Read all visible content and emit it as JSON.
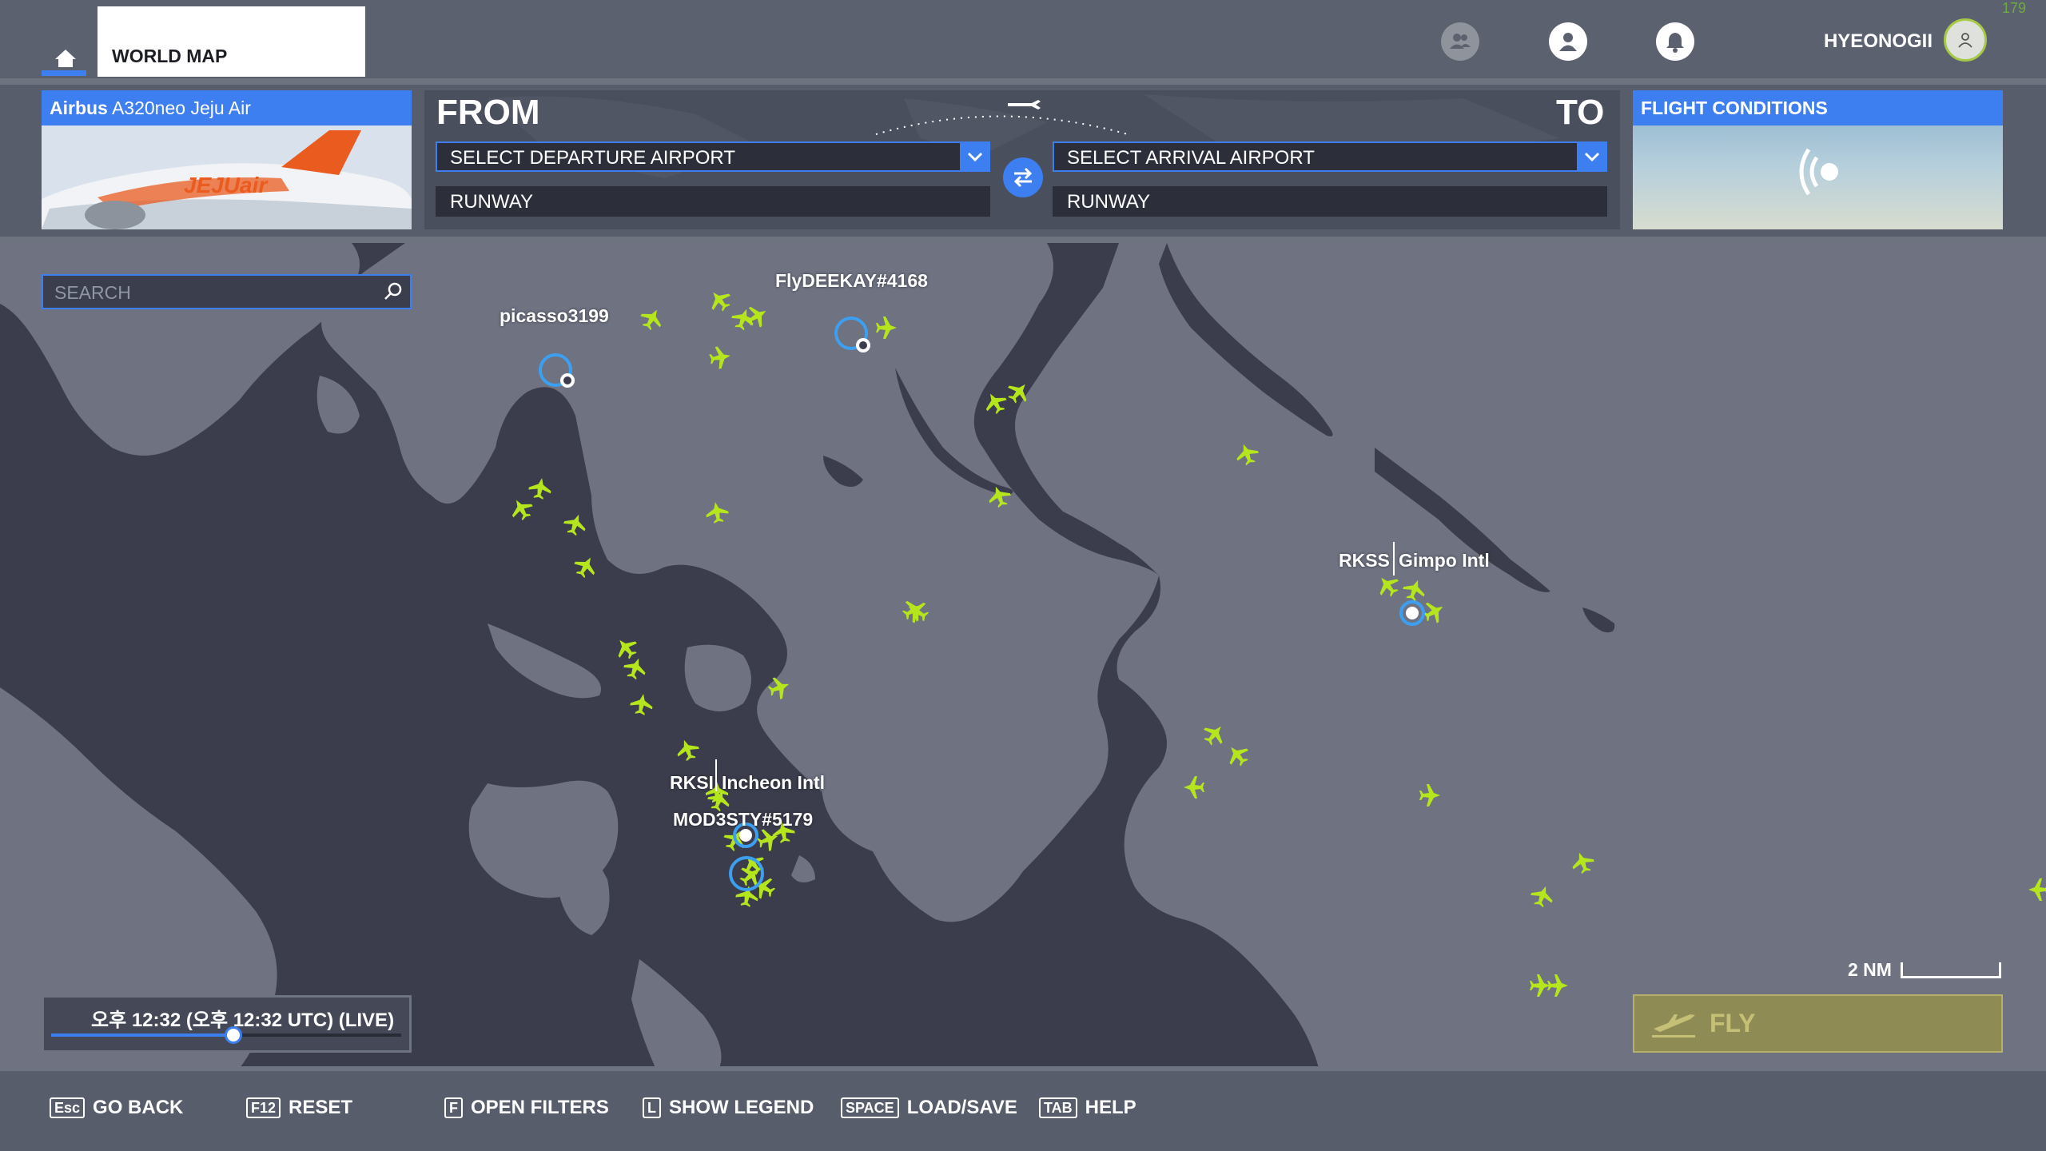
{
  "topbar": {
    "world_map_tab": "WORLD MAP",
    "username": "HYEONOGII",
    "corner_tag": "179",
    "icons": [
      "home-icon",
      "friends-icon",
      "profile-icon",
      "bell-icon",
      "avatar-icon"
    ]
  },
  "aircraft": {
    "maker": "Airbus",
    "model": "A320neo Jeju Air",
    "livery_logo_text": "JEJUair"
  },
  "route": {
    "from_label": "FROM",
    "to_label": "TO",
    "departure_placeholder": "SELECT DEPARTURE AIRPORT",
    "arrival_placeholder": "SELECT ARRIVAL AIRPORT",
    "departure_runway": "RUNWAY",
    "arrival_runway": "RUNWAY"
  },
  "conditions": {
    "title": "FLIGHT CONDITIONS",
    "icon": "live-weather-icon"
  },
  "map": {
    "search_placeholder": "SEARCH",
    "scale": "2 NM",
    "labels": {
      "picasso": "picasso3199",
      "flydeekay": "FlyDEEKAY#4168",
      "rkss_code": "RKSS",
      "rkss_name": "Gimpo Intl",
      "rksi_code": "RKSI",
      "rksi_name": "Incheon Intl",
      "mod3sty": "MOD3STY#5179"
    },
    "time": {
      "display": "오후 12:32 (오후 12:32 UTC) (LIVE)",
      "slider_fraction": 0.52
    },
    "traffic_color": "#b5e61d",
    "water_color": "#3b3d4c",
    "land_color": "#6e7281"
  },
  "fly_button": {
    "label": "FLY",
    "color": "#8f8b55"
  },
  "footer": {
    "hints": [
      {
        "key": "Esc",
        "label": "GO BACK"
      },
      {
        "key": "F12",
        "label": "RESET"
      },
      {
        "key": "F",
        "label": "OPEN FILTERS"
      },
      {
        "key": "L",
        "label": "SHOW LEGEND"
      },
      {
        "key": "SPACE",
        "label": "LOAD/SAVE"
      },
      {
        "key": "TAB",
        "label": "HELP"
      }
    ]
  }
}
